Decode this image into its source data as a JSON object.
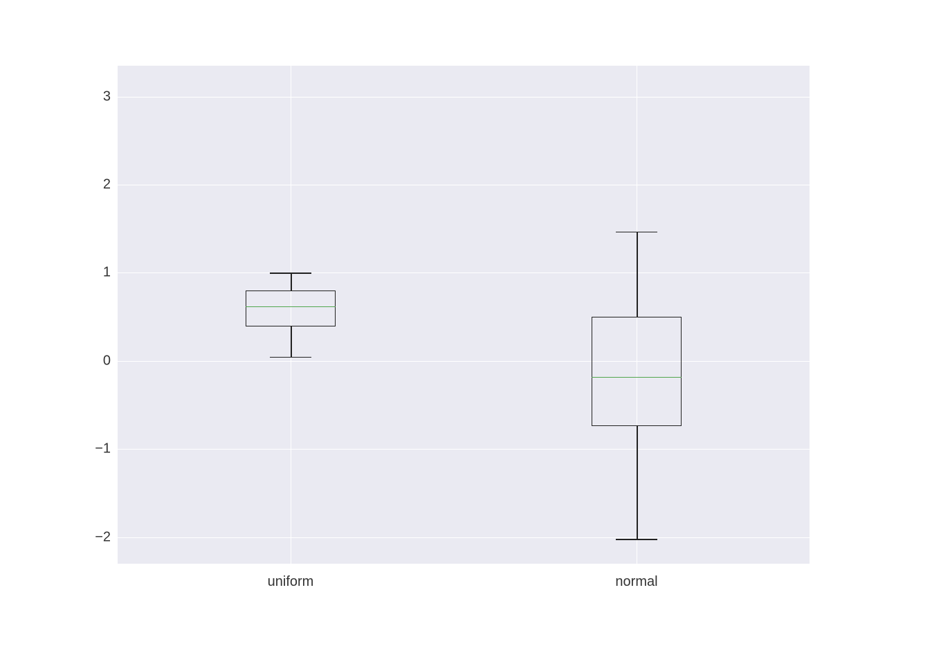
{
  "chart_data": {
    "type": "boxplot",
    "categories": [
      "uniform",
      "normal"
    ],
    "series": [
      {
        "name": "uniform",
        "whisker_low": 0.05,
        "q1": 0.39,
        "median": 0.62,
        "q3": 0.8,
        "whisker_high": 1.0
      },
      {
        "name": "normal",
        "whisker_low": -2.02,
        "q1": -0.74,
        "median": -0.18,
        "q3": 0.5,
        "whisker_high": 1.47
      }
    ],
    "ylim": [
      -2.3,
      3.35
    ],
    "y_ticks": [
      -2,
      -1,
      0,
      1,
      2,
      3
    ],
    "x_ticks": [
      "uniform",
      "normal"
    ],
    "median_color": "#51a64c",
    "box_border_color": "#222222",
    "plot_bg": "#eaeaf2",
    "grid_color": "#ffffff"
  }
}
